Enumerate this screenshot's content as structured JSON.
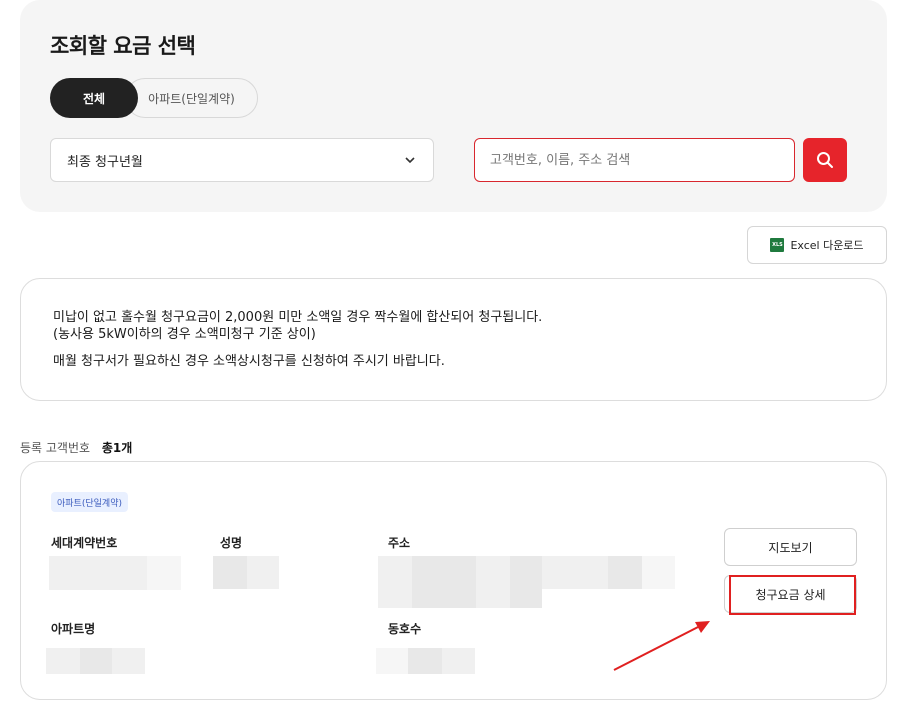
{
  "filter": {
    "title": "조회할 요금 선택",
    "tabs": [
      {
        "label": "전체",
        "active": true
      },
      {
        "label": "아파트(단일계약)",
        "active": false
      }
    ],
    "period_select": "최종 청구년월",
    "search": {
      "placeholder": "고객번호, 이름, 주소 검색",
      "icon": "search-icon"
    }
  },
  "excel_button": {
    "icon_text": "XLS",
    "label": "Excel 다운로드"
  },
  "notice": {
    "line1": "미납이 없고 홀수월 청구요금이 2,000원 미만 소액일 경우 짝수월에 합산되어 청구됩니다.",
    "line2": "(농사용 5kW이하의 경우 소액미청구 기준 상이)",
    "line3": "매월 청구서가 필요하신 경우 소액상시청구를 신청하여 주시기 바랍니다."
  },
  "registered": {
    "label": "등록 고객번호",
    "total": "총1개"
  },
  "card": {
    "badge": "아파트(단일계약)",
    "fields": {
      "contract_no": "세대계약번호",
      "name": "성명",
      "address": "주소",
      "apartment": "아파트명",
      "unit": "동호수"
    },
    "map_button": "지도보기",
    "detail_button": "청구요금 상세"
  },
  "colors": {
    "accent": "#e6242b",
    "dark_tab": "#222222",
    "panel_bg": "#f5f5f5"
  }
}
